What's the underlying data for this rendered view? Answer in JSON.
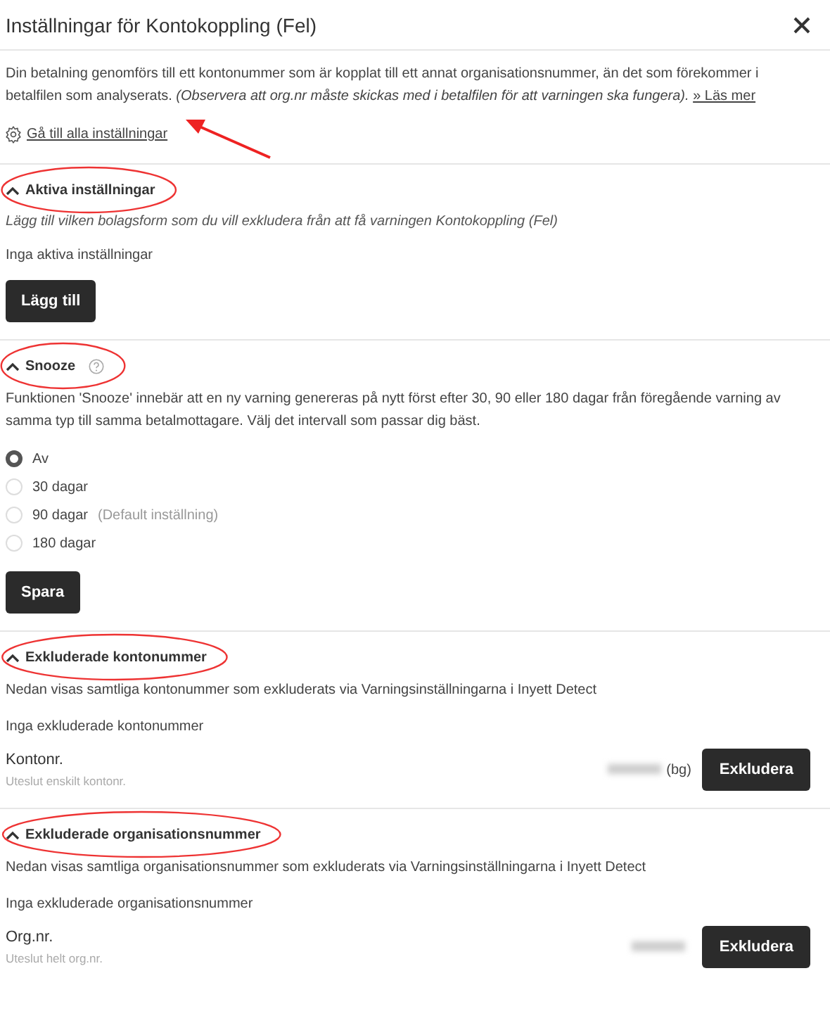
{
  "dialog": {
    "title": "Inställningar för Kontokoppling (Fel)"
  },
  "intro": {
    "text": "Din betalning genomförs till ett kontonummer som är kopplat till ett annat organisationsnummer, än det som förekommer i betalfilen som analyserats. *(Observera att org.nr måste skickas med i betalfilen för att varningen ska fungera).*",
    "read_more": "» Läs mer"
  },
  "settings_link": {
    "label": "Gå till alla inställningar",
    "arrow": true
  },
  "sections": [
    {
      "kind": "list",
      "title": "Aktiva inställningar",
      "expanded": true,
      "highlighted": true,
      "subtitle": "Lägg till vilken bolagsform som du vill exkludera från att få varningen Kontokoppling (Fel)",
      "empty_text": "Inga aktiva inställningar",
      "button": "Lägg till"
    },
    {
      "kind": "radio",
      "title": "Snooze",
      "expanded": true,
      "highlighted": true,
      "help": true,
      "description": "Funktionen 'Snooze' innebär att en ny varning genereras på nytt först efter 30, 90 eller 180 dagar från föregående varning av samma typ till samma betalmottagare. Välj det intervall som passar dig bäst.",
      "options": [
        {
          "label": "Av",
          "selected": true
        },
        {
          "label": "30 dagar",
          "selected": false
        },
        {
          "label": "90 dagar",
          "note": "(Default inställning)",
          "selected": false
        },
        {
          "label": "180 dagar",
          "selected": false
        }
      ],
      "button": "Spara"
    },
    {
      "kind": "exclude",
      "title": "Exkluderade kontonummer",
      "expanded": true,
      "highlighted": true,
      "description": "Nedan visas samtliga kontonummer som exkluderats via Varningsinställningarna i Inyett Detect",
      "empty_text": "Inga exkluderade kontonummer",
      "field_label": "Kontonr.",
      "field_hint": "Uteslut enskilt kontonr.",
      "suffix": "(bg)",
      "button": "Exkludera"
    },
    {
      "kind": "exclude",
      "title": "Exkluderade organisationsnummer",
      "expanded": true,
      "highlighted": true,
      "description": "Nedan visas samtliga organisationsnummer som exkluderats via Varningsinställningarna i Inyett Detect",
      "empty_text": "Inga exkluderade organisationsnummer",
      "field_label": "Org.nr.",
      "field_hint": "Uteslut helt org.nr.",
      "button": "Exkludera"
    }
  ]
}
